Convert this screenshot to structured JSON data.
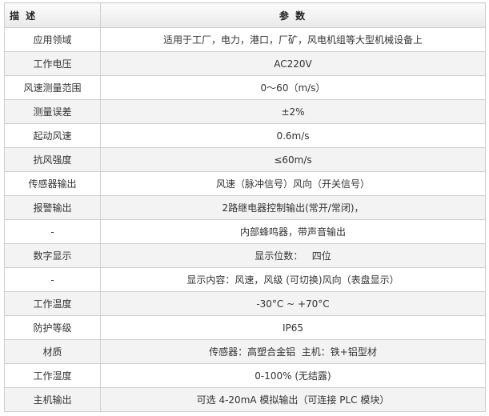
{
  "table": {
    "headers": {
      "description": "描 述",
      "parameters": "参 数"
    },
    "rows": [
      {
        "label": "应用领域",
        "value": "适用于工厂，电力，港口，厂矿，风电机组等大型机械设备上"
      },
      {
        "label": "工作电压",
        "value": "AC220V"
      },
      {
        "label": "风速测量范围",
        "value": "0～60（m/s）"
      },
      {
        "label": "测量误差",
        "value": "±2%"
      },
      {
        "label": "起动风速",
        "value": "0.6m/s"
      },
      {
        "label": "抗风强度",
        "value": "≤60m/s"
      },
      {
        "label": "传感器输出",
        "value": "风速（脉冲信号）风向（开关信号）"
      },
      {
        "label": "报警输出",
        "value": "2路继电器控制输出(常开/常闭)，"
      },
      {
        "label": "-",
        "value": "内部蜂鸣器，带声音输出"
      },
      {
        "label": "数字显示",
        "value": "显示位数：   四位"
      },
      {
        "label": "-",
        "value": "显示内容：风速，风级 (可切换)风向（表盘显示）"
      },
      {
        "label": "工作温度",
        "value": "-30°C ~ +70°C"
      },
      {
        "label": "防护等级",
        "value": "IP65"
      },
      {
        "label": "材质",
        "value": "传感器：高塑合金铝  主机：铁+铝型材"
      },
      {
        "label": "工作湿度",
        "value": "0-100% (无结露)"
      },
      {
        "label": "主机输出",
        "value": "可选 4-20mA 模拟输出（可连接 PLC 模块）"
      }
    ]
  }
}
